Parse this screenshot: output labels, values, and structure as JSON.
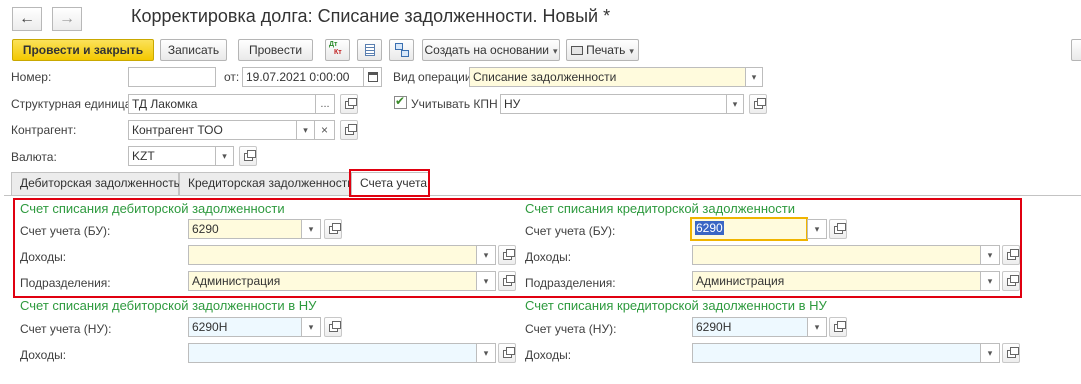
{
  "window": {
    "title": "Корректировка долга: Списание задолженности. Новый *"
  },
  "nav": {
    "back_glyph": "←",
    "forward_glyph": "→"
  },
  "toolbar": {
    "post_close": "Провести и закрыть",
    "save": "Записать",
    "post": "Провести",
    "dtkt_icon_top": "Дт",
    "dtkt_icon_bottom": "Кт",
    "create_basis": "Создать на основании",
    "print": "Печать",
    "dropdown_glyph": "▾"
  },
  "header": {
    "number_label": "Номер:",
    "number_value": "",
    "date_label": "от:",
    "date_value": "19.07.2021  0:00:00",
    "operation_label": "Вид операции:",
    "operation_value": "Списание задолженности",
    "unit_label": "Структурная единица:",
    "unit_value": "ТД Лакомка",
    "kpn_label": "Учитывать КПН",
    "kpn_checked": true,
    "kpn_value": "НУ",
    "counterparty_label": "Контрагент:",
    "counterparty_value": "Контрагент ТОО",
    "currency_label": "Валюта:",
    "currency_value": "KZT"
  },
  "tabs": [
    {
      "label": "Дебиторская задолженность",
      "active": false
    },
    {
      "label": "Кредиторская задолженность",
      "active": false
    },
    {
      "label": "Счета учета",
      "active": true
    }
  ],
  "debit": {
    "title": "Счет списания дебиторской задолженности",
    "account_label": "Счет учета (БУ):",
    "account_value": "6290",
    "income_label": "Доходы:",
    "income_value": "",
    "division_label": "Подразделения:",
    "division_value": "Администрация"
  },
  "credit": {
    "title": "Счет списания кредиторской задолженности",
    "account_label": "Счет учета (БУ):",
    "account_value": "6290",
    "income_label": "Доходы:",
    "income_value": "",
    "division_label": "Подразделения:",
    "division_value": "Администрация"
  },
  "debit_nu": {
    "title": "Счет списания дебиторской задолженности в НУ",
    "account_label": "Счет учета (НУ):",
    "account_value": "6290Н",
    "income_label": "Доходы:",
    "income_value": ""
  },
  "credit_nu": {
    "title": "Счет списания кредиторской задолженности в НУ",
    "account_label": "Счет учета (НУ):",
    "account_value": "6290Н",
    "income_label": "Доходы:",
    "income_value": ""
  },
  "glyphs": {
    "dropdown": "▾",
    "ellipsis": "...",
    "clear": "×",
    "check": "✔"
  },
  "colors": {
    "section_title": "#2e9a3e",
    "highlight_frame": "#e00010",
    "primary_button": "#f3c800",
    "focus_border": "#f0b400",
    "selection": "#3a66c4"
  }
}
